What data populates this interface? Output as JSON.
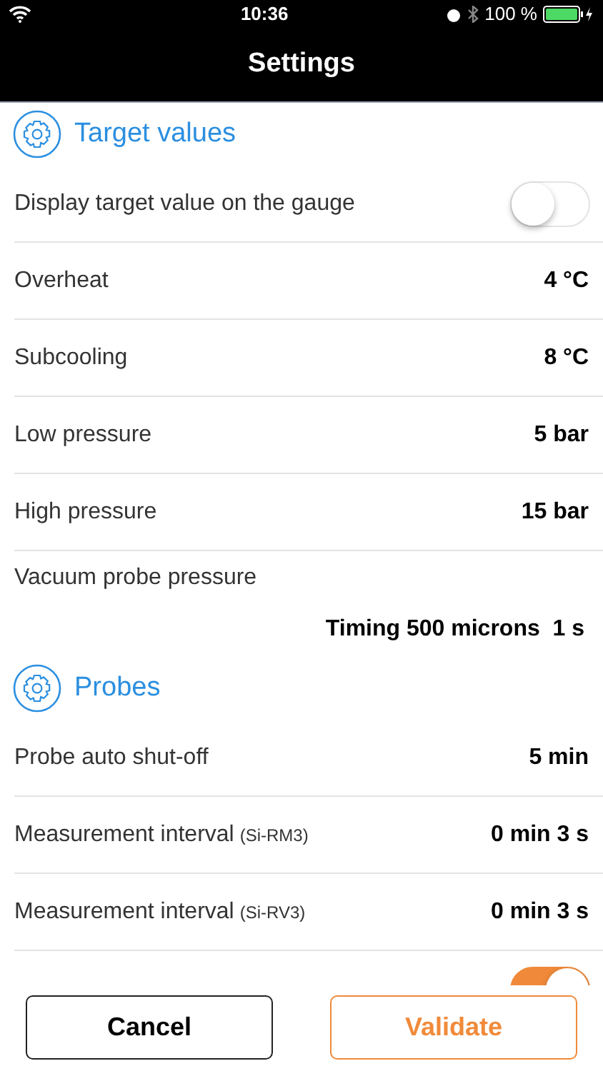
{
  "status_bar": {
    "time": "10:36",
    "battery": "100 %"
  },
  "window": {
    "title": "Settings"
  },
  "sections": [
    {
      "title": "Target values",
      "rows": [
        {
          "kind": "toggle",
          "label": "Display target value on the gauge",
          "on": false
        },
        {
          "kind": "value",
          "label": "Overheat",
          "value": "4 °C"
        },
        {
          "kind": "value",
          "label": "Subcooling",
          "value": "8 °C"
        },
        {
          "kind": "value",
          "label": "Low pressure",
          "value": "5 bar"
        },
        {
          "kind": "value",
          "label": "High pressure",
          "value": "15 bar"
        },
        {
          "kind": "stacked",
          "label": "Vacuum probe pressure",
          "value": "Timing 500 microns  1 s"
        }
      ]
    },
    {
      "title": "Probes",
      "rows": [
        {
          "kind": "value",
          "label": "Probe auto shut-off",
          "value": "5 min"
        },
        {
          "kind": "value",
          "label": "Measurement interval",
          "note": "(Si-RM3)",
          "value": "0 min 3 s"
        },
        {
          "kind": "value",
          "label": "Measurement interval",
          "note": "(Si-RV3)",
          "value": "0 min 3 s"
        },
        {
          "kind": "toggle",
          "on": true
        }
      ]
    }
  ],
  "buttons": [
    {
      "label": "Cancel",
      "kind": "secondary"
    },
    {
      "label": "Validate",
      "kind": "primary"
    }
  ]
}
